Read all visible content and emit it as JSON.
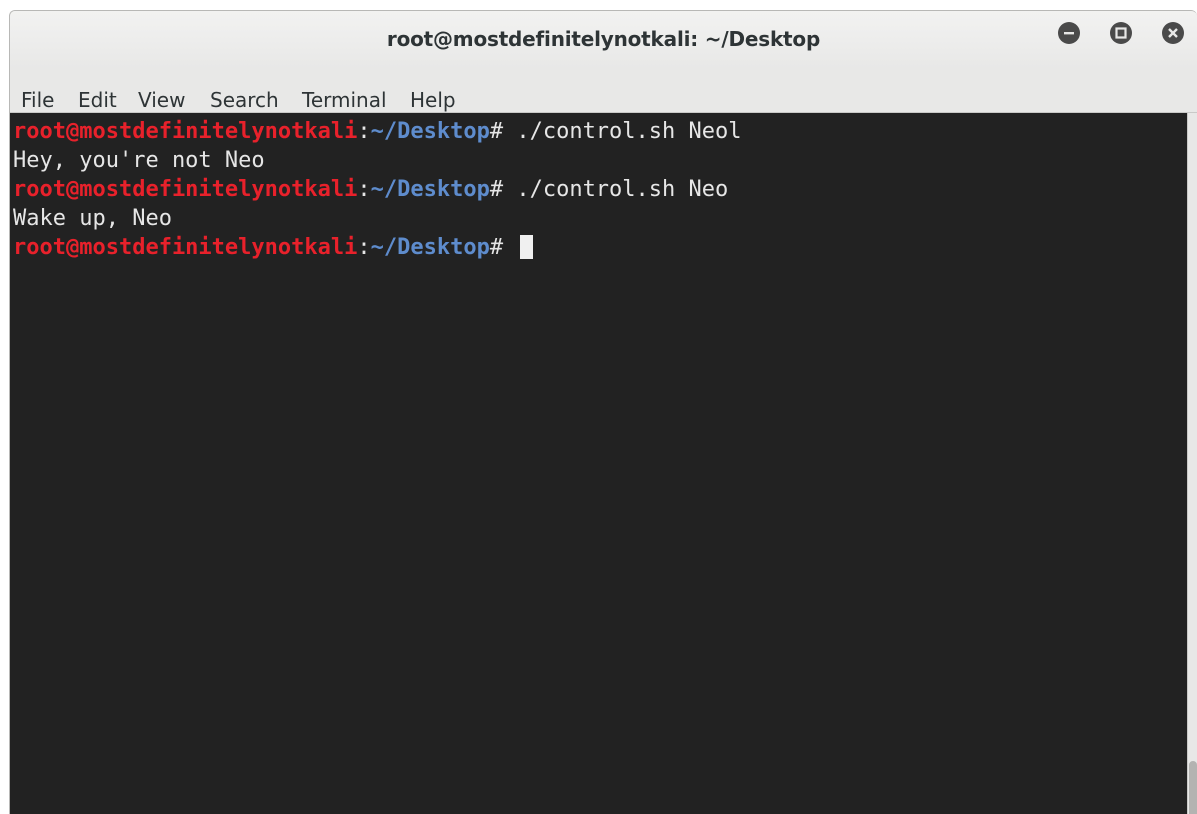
{
  "window": {
    "title": "root@mostdefinitelynotkali: ~/Desktop"
  },
  "controls": {
    "minimize_icon": "minimize-icon",
    "maximize_icon": "maximize-icon",
    "close_icon": "close-icon"
  },
  "menu": {
    "items": [
      {
        "label": "File"
      },
      {
        "label": "Edit"
      },
      {
        "label": "View"
      },
      {
        "label": "Search"
      },
      {
        "label": "Terminal"
      },
      {
        "label": "Help"
      }
    ]
  },
  "terminal": {
    "prompt": {
      "user_host": "root@mostdefinitelynotkali",
      "separator": ":",
      "path": "~/Desktop",
      "symbol": "#"
    },
    "lines": [
      {
        "type": "command",
        "command": " ./control.sh Neol"
      },
      {
        "type": "output",
        "text": "Hey, you're not Neo"
      },
      {
        "type": "command",
        "command": " ./control.sh Neo"
      },
      {
        "type": "output",
        "text": "Wake up, Neo"
      },
      {
        "type": "command",
        "command": " "
      }
    ]
  },
  "colors": {
    "prompt_user": "#e8212b",
    "prompt_path": "#5e8ccd",
    "terminal_bg": "#222222",
    "terminal_fg": "#e6e6e6"
  }
}
